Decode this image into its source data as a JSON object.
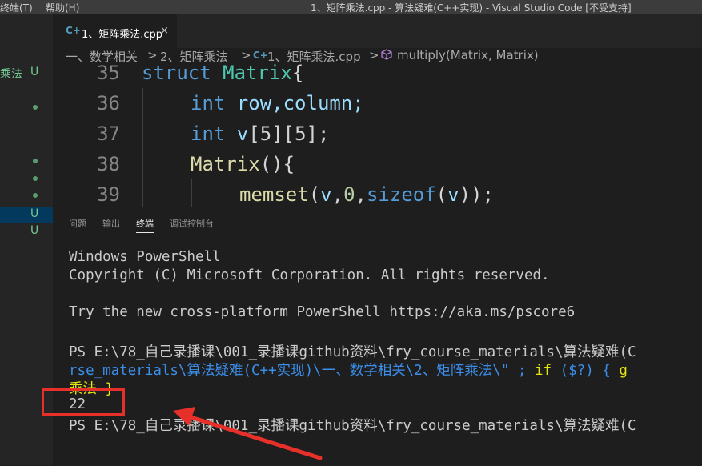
{
  "titlebar": {
    "menu_terminal": "终端(T)",
    "menu_help": "帮助(H)",
    "window_title": "1、矩阵乘法.cpp - 算法疑难(C++实现) - Visual Studio Code [不受支持]"
  },
  "sidebar": {
    "folder_label": "乘法",
    "folder_status": "U",
    "u_markers": [
      "U",
      "U"
    ]
  },
  "tab": {
    "icon_text": "C+",
    "label": "1、矩阵乘法.cpp",
    "close_glyph": "×"
  },
  "breadcrumb": {
    "part1": "一、数学相关",
    "part2": "2、矩阵乘法",
    "part3": "1、矩阵乘法.cpp",
    "part4": "multiply(Matrix, Matrix)",
    "separator": ">"
  },
  "editor": {
    "line_numbers": [
      "35",
      "36",
      "37",
      "38",
      "39"
    ],
    "line35": {
      "kw": "struct",
      "ty": "Matrix",
      "rest": "{"
    },
    "line36": {
      "kw": "int",
      "rest": " row,column;"
    },
    "line37": {
      "kw": "int",
      "va": " v",
      "rest": "[5][5];"
    },
    "line38": {
      "fn": "Matrix",
      "rest": "(){"
    },
    "line39": {
      "fn": "memset",
      "p1": "(",
      "va": "v",
      "p2": ",",
      "nu": "0",
      "p3": ",",
      "kw": "sizeof",
      "p4": "(",
      "va2": "v",
      "p5": "));"
    }
  },
  "panel": {
    "tabs": [
      "问题",
      "输出",
      "终端",
      "调试控制台"
    ],
    "active_tab": "终端"
  },
  "terminal": {
    "line1": "Windows PowerShell",
    "line2": "Copyright (C) Microsoft Corporation. All rights reserved.",
    "line3": "Try the new cross-platform PowerShell https://aka.ms/pscore6",
    "line4": "PS E:\\78_自己录播课\\001_录播课github资料\\fry_course_materials\\算法疑难(C",
    "line5_cyan": "rse_materials\\算法疑难(C++实现)\\一、数学相关\\2、矩阵乘法\\\" ; ",
    "line5_kw": "if",
    "line5_rest": " ($?) { ",
    "line5_yellow": "g",
    "line6": "乘法 }",
    "output": "22",
    "line8": "PS E:\\78_自己录播课\\001_录播课github资料\\fry_course_materials\\算法疑难(C"
  },
  "colors": {
    "annotation_red": "#e8302a",
    "u_green": "#73c991"
  }
}
